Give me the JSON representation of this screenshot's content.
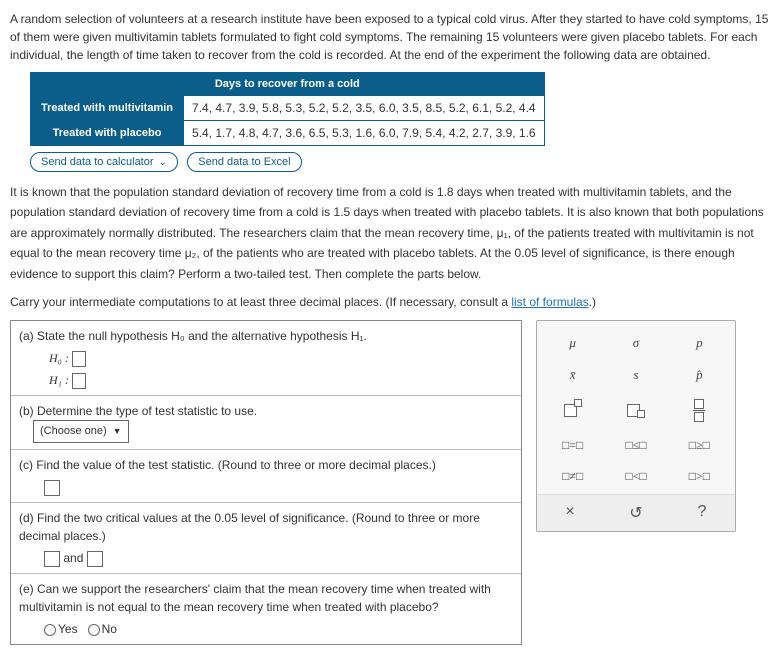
{
  "intro": "A random selection of volunteers at a research institute have been exposed to a typical cold virus. After they started to have cold symptoms, 15 of them were given multivitamin tablets formulated to fight cold symptoms. The remaining 15 volunteers were given placebo tablets. For each individual, the length of time taken to recover from the cold is recorded. At the end of the experiment the following data are obtained.",
  "table": {
    "header": "Days to recover from a cold",
    "row1_label": "Treated with multivitamin",
    "row1_vals": "7.4, 4.7, 3.9, 5.8, 5.3, 5.2, 5.2, 3.5, 6.0, 3.5, 8.5, 5.2, 6.1, 5.2, 4.4",
    "row2_label": "Treated with placebo",
    "row2_vals": "5.4, 1.7, 4.8, 4.7, 3.6, 6.5, 5.3, 1.6, 6.0, 7.9, 5.4, 4.2, 2.7, 3.9, 1.6"
  },
  "btns": {
    "calc": "Send data to calculator",
    "excel": "Send data to Excel"
  },
  "explain": {
    "p1a": "It is known that the population standard deviation of recovery time from a cold is ",
    "v1": "1.8",
    "p1b": " days when treated with multivitamin tablets, and the population standard deviation of recovery time from a cold is ",
    "v2": "1.5",
    "p1c": " days when treated with placebo tablets. It is also known that both populations are approximately normally distributed. The researchers claim that the mean recovery time, ",
    "mu1": "μ₁",
    "p1d": ", of the patients treated with multivitamin is not equal to the mean recovery time ",
    "mu2": "μ₂",
    "p1e": ", of the patients who are treated with placebo tablets. At the ",
    "alpha": "0.05",
    "p1f": " level of significance, is there enough evidence to support this claim? Perform a two-tailed test. Then complete the parts below.",
    "carry": "Carry your intermediate computations to at least three decimal places. (If necessary, consult a ",
    "link": "list of formulas",
    "carry2": ".)"
  },
  "parts": {
    "a": "(a)  State the null hypothesis H₀ and the alternative hypothesis H₁.",
    "a_h0": "H₀  :",
    "a_h1": "H₁  :",
    "b": "(b)  Determine the type of test statistic to use.",
    "b_choose": "(Choose one)",
    "c": "(c)  Find the value of the test statistic. (Round to three or more decimal places.)",
    "d": "(d)  Find the two critical values at the 0.05 level of significance. (Round to three or more decimal places.)",
    "d_and": "and",
    "e": "(e)  Can we support the researchers' claim that the mean recovery time when treated with multivitamin is not equal to the mean recovery time when treated with placebo?",
    "yes": "Yes",
    "no": "No"
  },
  "palette": {
    "r1": [
      "μ",
      "σ",
      "p"
    ],
    "r2": [
      "x̄",
      "s",
      "p̂"
    ],
    "r5": [
      "□=□",
      "□≤□",
      "□≥□"
    ],
    "r6": [
      "□≠□",
      "□<□",
      "□>□"
    ],
    "footer": [
      "×",
      "↺",
      "?"
    ]
  }
}
